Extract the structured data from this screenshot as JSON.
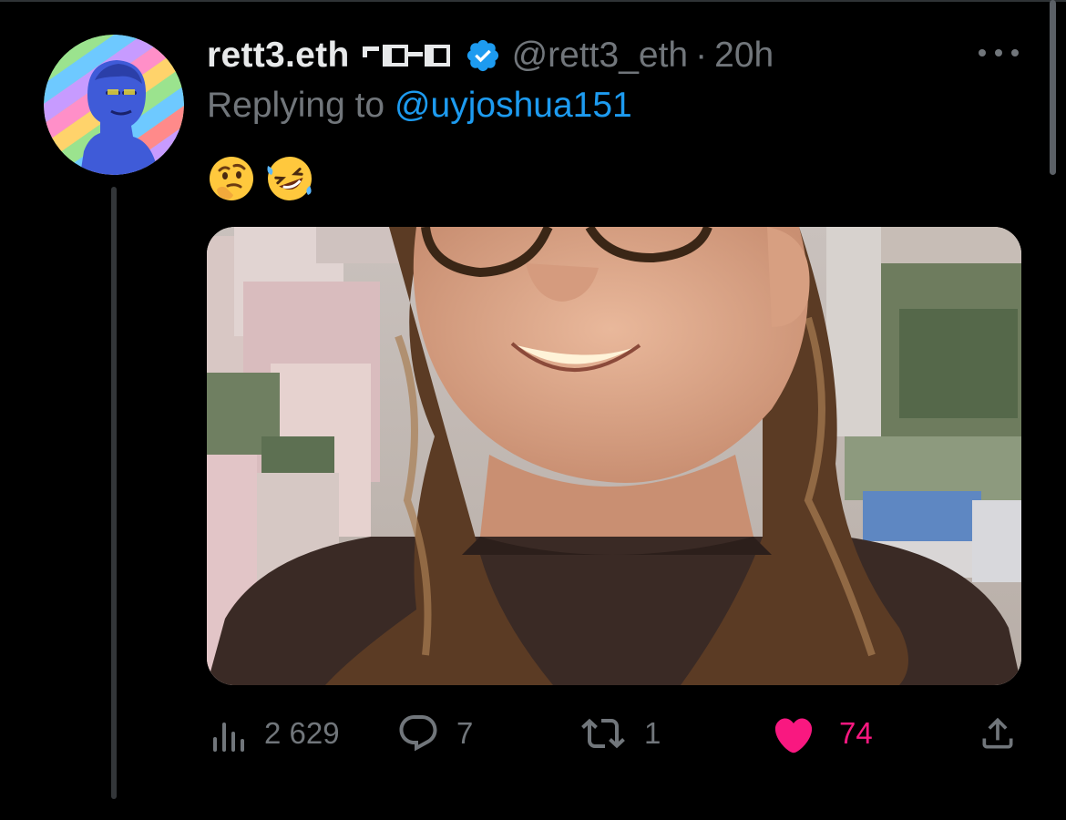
{
  "tweet": {
    "display_name": "rett3.eth",
    "handle": "@rett3_eth",
    "separator": "·",
    "time": "20h",
    "replying_prefix": "Replying to ",
    "replying_to": "@uyjoshua151",
    "emojis": [
      "thinking-face",
      "rolling-on-floor-laughing"
    ],
    "media_description": "photo"
  },
  "actions": {
    "views": "2 629",
    "replies": "7",
    "retweets": "1",
    "likes": "74"
  },
  "icons": {
    "header": [
      "glasses-icon",
      "verified-badge-icon",
      "more-icon"
    ],
    "actions": [
      "views-icon",
      "reply-icon",
      "retweet-icon",
      "heart-icon",
      "share-icon"
    ]
  },
  "colors": {
    "background": "#000000",
    "text_primary": "#e7e9ea",
    "text_secondary": "#71767b",
    "link": "#1d9bf0",
    "like_active": "#f91880",
    "verified": "#1d9bf0"
  }
}
